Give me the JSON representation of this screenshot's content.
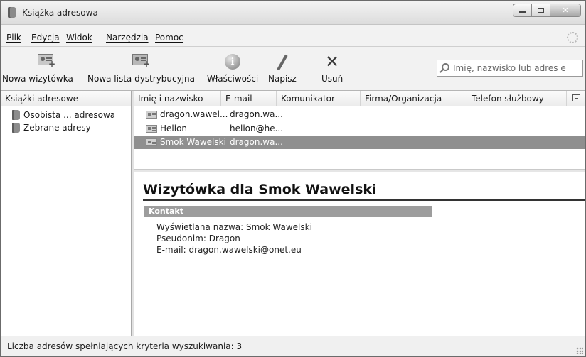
{
  "window": {
    "title": "Książka adresowa"
  },
  "menu": {
    "items": [
      {
        "label": "Plik"
      },
      {
        "label": "Edycja"
      },
      {
        "label": "Widok"
      },
      {
        "label": "Narzędzia"
      },
      {
        "label": "Pomoc"
      }
    ]
  },
  "toolbar": {
    "new_card": "Nowa wizytówka",
    "new_list": "Nowa lista dystrybucyjna",
    "properties": "Właściwości",
    "write": "Napisz",
    "delete": "Usuń",
    "search_placeholder": "Imię, nazwisko lub adres e"
  },
  "left_pane": {
    "header": "Książki adresowe",
    "books": [
      {
        "label": "Osobista ... adresowa"
      },
      {
        "label": "Zebrane adresy"
      }
    ]
  },
  "results": {
    "columns": [
      {
        "label": "Imię i nazwisko"
      },
      {
        "label": "E-mail"
      },
      {
        "label": "Komunikator"
      },
      {
        "label": "Firma/Organizacja"
      },
      {
        "label": "Telefon służbowy"
      }
    ],
    "rows": [
      {
        "name": "dragon.wawel...",
        "email": "dragon.wa..."
      },
      {
        "name": "Helion",
        "email": "helion@he..."
      },
      {
        "name": "Smok Wawelski",
        "email": "dragon.wa...",
        "selected": true
      }
    ]
  },
  "card": {
    "title": "Wizytówka dla Smok Wawelski",
    "section": "Kontakt",
    "display_name": "Wyświetlana nazwa: Smok Wawelski",
    "nickname": "Pseudonim: Dragon",
    "email": "E-mail: dragon.wawelski@onet.eu"
  },
  "status": {
    "text": "Liczba adresów spełniających kryteria wyszukiwania: 3"
  }
}
